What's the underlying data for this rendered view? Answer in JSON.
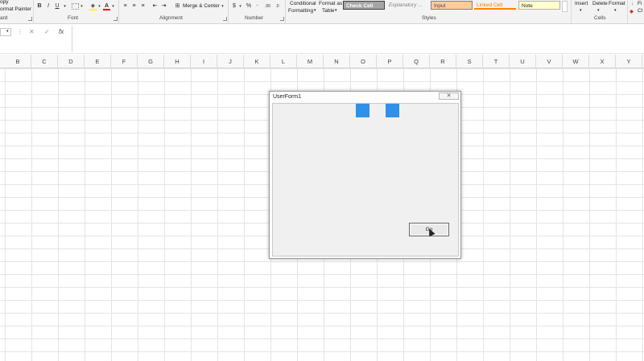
{
  "ribbon": {
    "clipboard": {
      "copy": "opy",
      "format_painter": "ormat Painter",
      "group_label": "ard"
    },
    "font": {
      "bold": "B",
      "italic": "I",
      "underline": "U",
      "font_color_glyph": "A",
      "group_label": "Font"
    },
    "alignment": {
      "merge_center": "Merge & Center",
      "group_label": "Alignment"
    },
    "number": {
      "currency": "$",
      "percent": "%",
      "group_label": "Number"
    },
    "styles": {
      "conditional_line1": "Conditional",
      "conditional_line2": "Formatting",
      "format_table_line1": "Format as",
      "format_table_line2": "Table",
      "check_cell": "Check Cell",
      "explanatory": "Explanatory ...",
      "input": "Input",
      "linked_cell": "Linked Cell",
      "note": "Note",
      "group_label": "Styles"
    },
    "cells": {
      "insert": "Insert",
      "delete": "Delete",
      "format": "Format",
      "group_label": "Cells"
    },
    "editing": {
      "fill": "Fi",
      "clear": "Cl"
    }
  },
  "formula_bar": {
    "cancel": "✕",
    "enter": "✓",
    "fx": "fx",
    "value": ""
  },
  "columns": [
    "B",
    "C",
    "D",
    "E",
    "F",
    "G",
    "H",
    "I",
    "J",
    "K",
    "L",
    "M",
    "N",
    "O",
    "P",
    "Q",
    "R",
    "S",
    "T",
    "U",
    "V",
    "W",
    "X",
    "Y"
  ],
  "userform": {
    "title": "UserForm1",
    "close_glyph": "✕",
    "go_label": "Go"
  },
  "colors": {
    "accent_blue": "#2f91e8"
  }
}
